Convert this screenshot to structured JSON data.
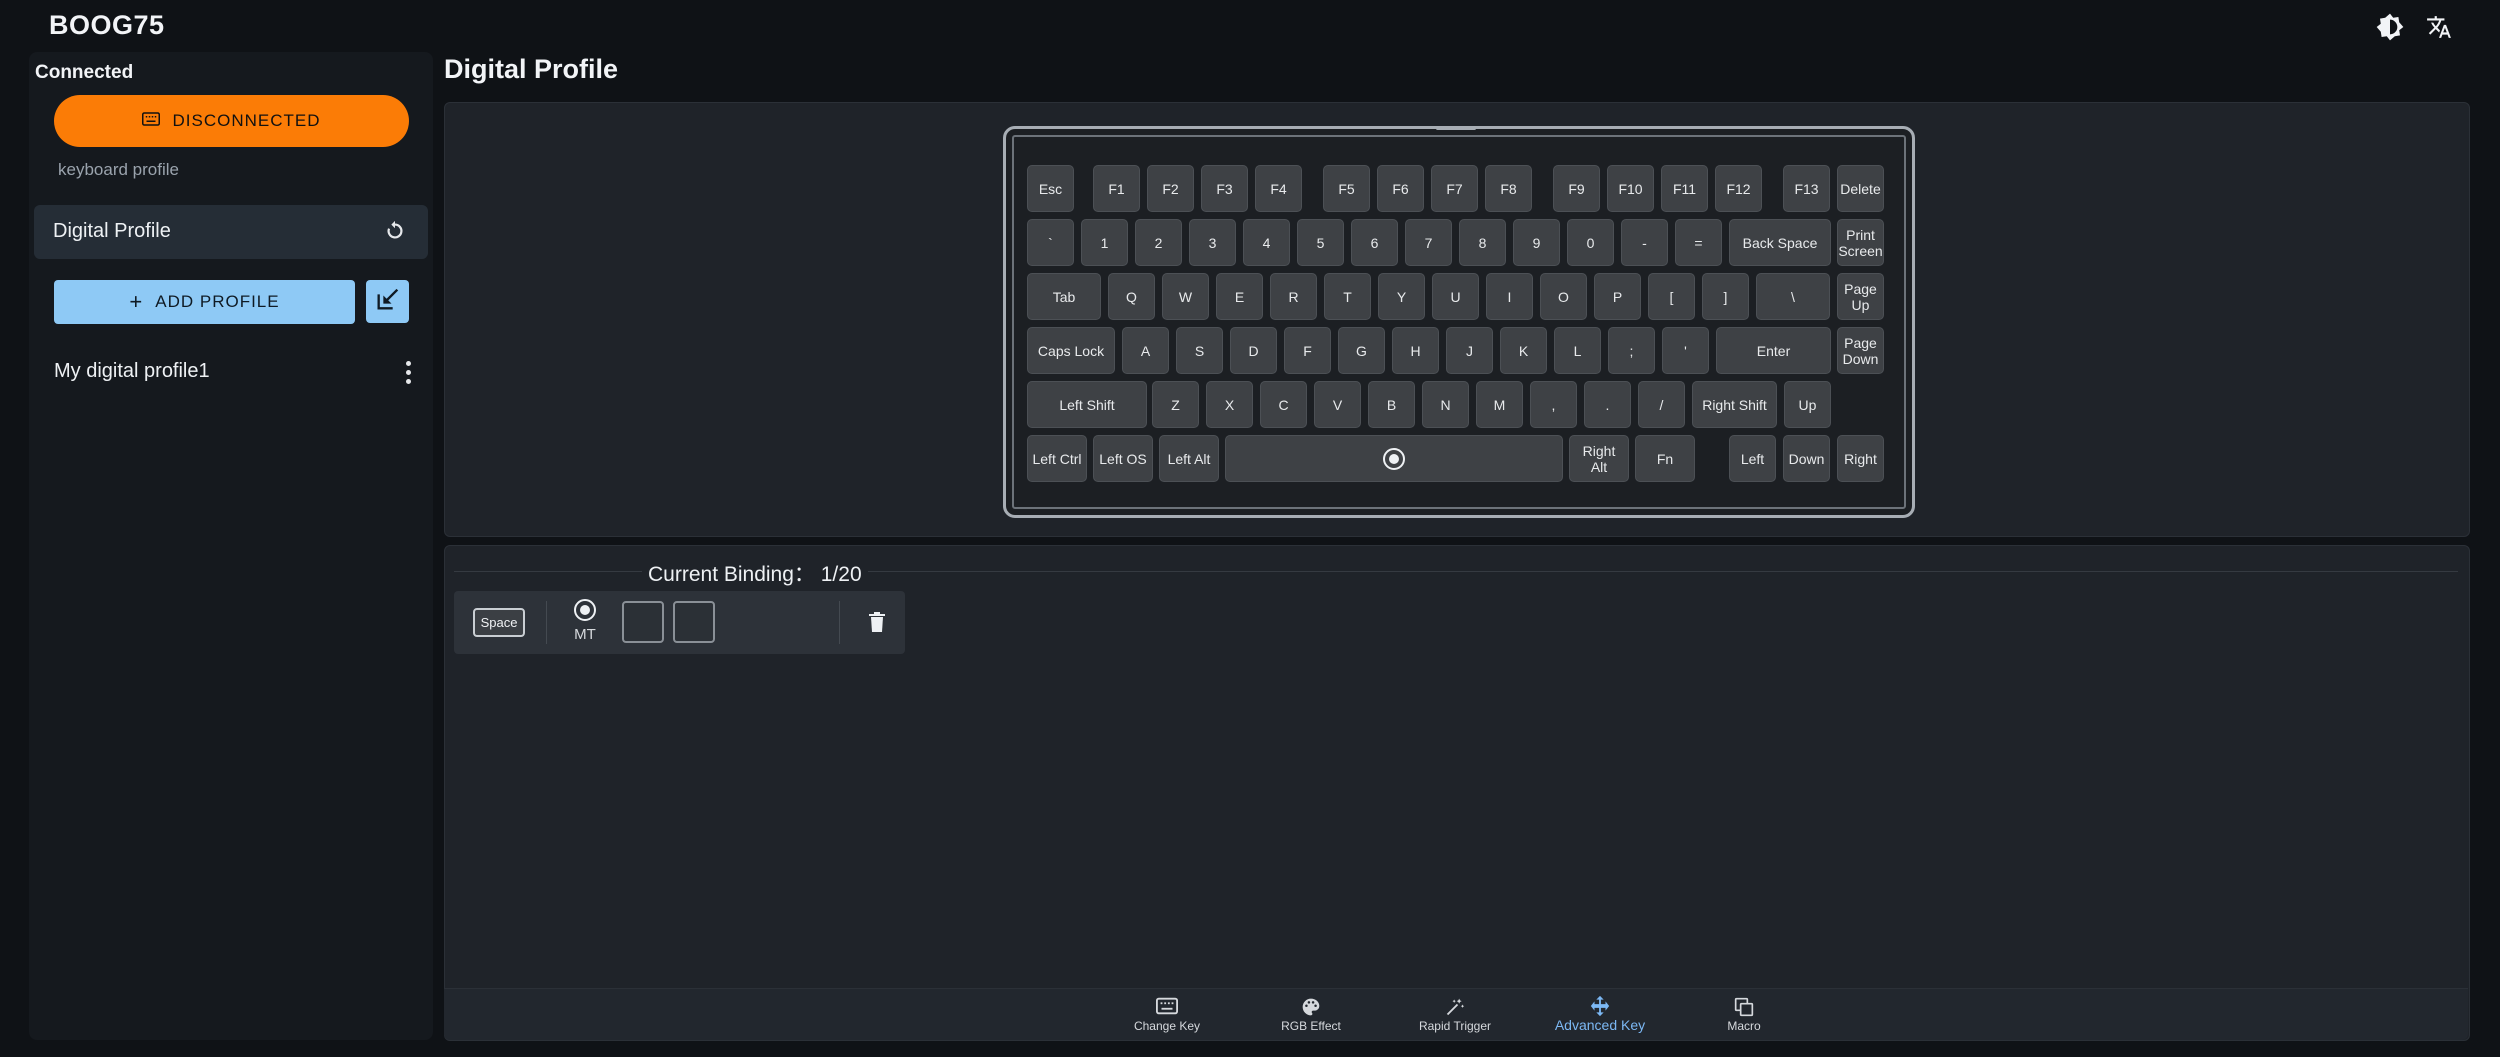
{
  "app": {
    "title": "BOOG75"
  },
  "sidebar": {
    "status_label": "Connected",
    "device_button_label": "DISCONNECTED",
    "section_label": "keyboard profile",
    "active_profile": "Digital Profile",
    "add_profile_label": "ADD PROFILE",
    "profiles": [
      {
        "name": "My digital profile1"
      }
    ]
  },
  "main": {
    "title": "Digital Profile",
    "binding": {
      "title": "Current Binding： 1/20",
      "key_label": "Space",
      "mode_label": "MT"
    }
  },
  "keyboard": {
    "rows": [
      [
        "Esc",
        "F1",
        "F2",
        "F3",
        "F4",
        "F5",
        "F6",
        "F7",
        "F8",
        "F9",
        "F10",
        "F11",
        "F12",
        "F13",
        "Delete"
      ],
      [
        "`",
        "1",
        "2",
        "3",
        "4",
        "5",
        "6",
        "7",
        "8",
        "9",
        "0",
        "-",
        "=",
        "Back Space",
        "Print Screen"
      ],
      [
        "Tab",
        "Q",
        "W",
        "E",
        "R",
        "T",
        "Y",
        "U",
        "I",
        "O",
        "P",
        "[",
        "]",
        "\\",
        "Page Up"
      ],
      [
        "Caps Lock",
        "A",
        "S",
        "D",
        "F",
        "G",
        "H",
        "J",
        "K",
        "L",
        ";",
        "'",
        "Enter",
        "Page Down"
      ],
      [
        "Left Shift",
        "Z",
        "X",
        "C",
        "V",
        "B",
        "N",
        "M",
        ",",
        ".",
        "/",
        "Right Shift",
        "Up"
      ],
      [
        "Left Ctrl",
        "Left OS",
        "Left Alt",
        "",
        "Right Alt",
        "Fn",
        "Left",
        "Down",
        "Right"
      ]
    ]
  },
  "bottom_nav": [
    {
      "label": "Change Key",
      "icon": "keyboard-icon"
    },
    {
      "label": "RGB Effect",
      "icon": "palette-icon"
    },
    {
      "label": "Rapid Trigger",
      "icon": "magic-wand-icon"
    },
    {
      "label": "Advanced Key",
      "icon": "move-arrows-icon",
      "active": true
    },
    {
      "label": "Macro",
      "icon": "stack-icon"
    }
  ],
  "colors": {
    "accent_orange": "#fb7c06",
    "accent_blue": "#8ec9f5",
    "active_nav": "#7cb8f4"
  }
}
